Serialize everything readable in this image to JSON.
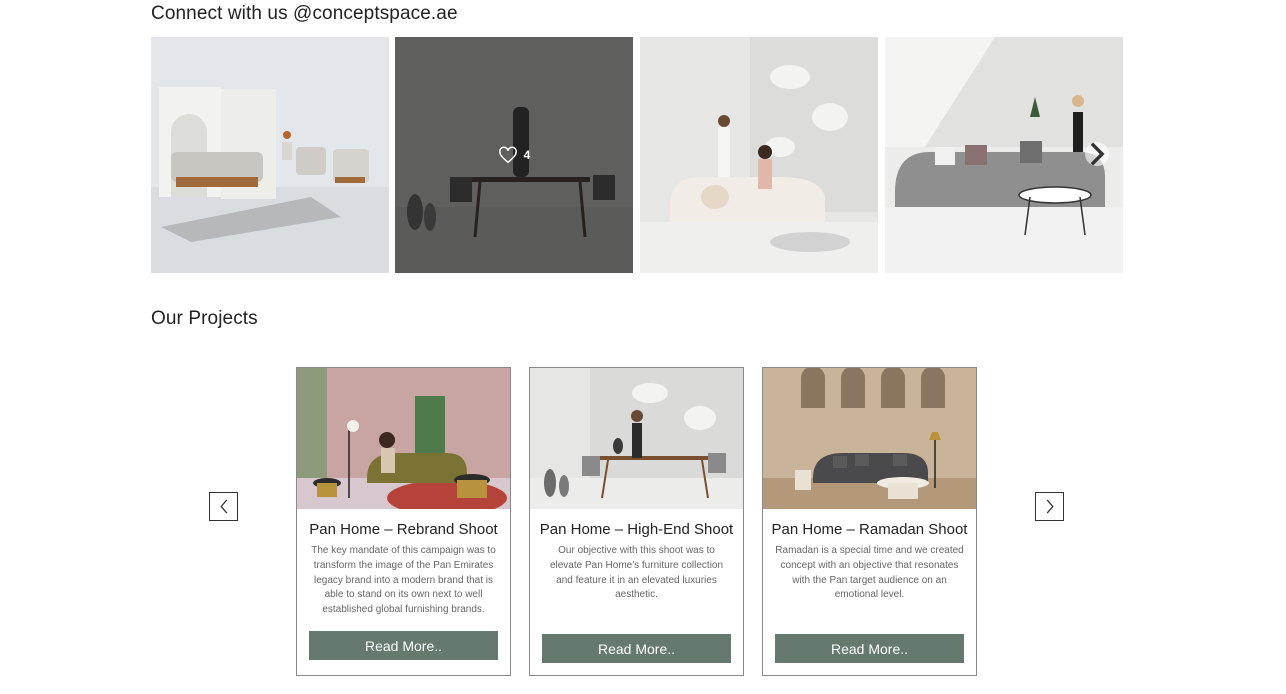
{
  "instagram": {
    "title": "Connect with us @conceptspace.ae",
    "tiles": [
      {
        "likes": ""
      },
      {
        "likes": "4"
      },
      {
        "likes": ""
      },
      {
        "likes": ""
      }
    ],
    "next_icon": "chevron-right-icon"
  },
  "projects": {
    "title": "Our Projects",
    "prev_icon": "chevron-left-icon",
    "next_icon": "chevron-right-icon",
    "cards": [
      {
        "title": "Pan Home – Rebrand Shoot",
        "description": "The key mandate of this campaign was to transform the image of the Pan Emirates legacy brand into a modern brand that is able to stand on its own next to well established global furnishing brands.",
        "button": "Read More.."
      },
      {
        "title": "Pan Home – High-End Shoot",
        "description": "Our objective with this shoot was to elevate Pan Home's furniture collection and feature it in an elevated luxuries aesthetic.",
        "button": "Read More.."
      },
      {
        "title": "Pan Home – Ramadan Shoot",
        "description": "Ramadan is a special time and we created concept with an objective that resonates with the Pan target audience on an emotional level.",
        "button": "Read More.."
      }
    ]
  },
  "colors": {
    "button_bg": "#66796f",
    "text": "#222222",
    "muted_text": "#666666"
  }
}
